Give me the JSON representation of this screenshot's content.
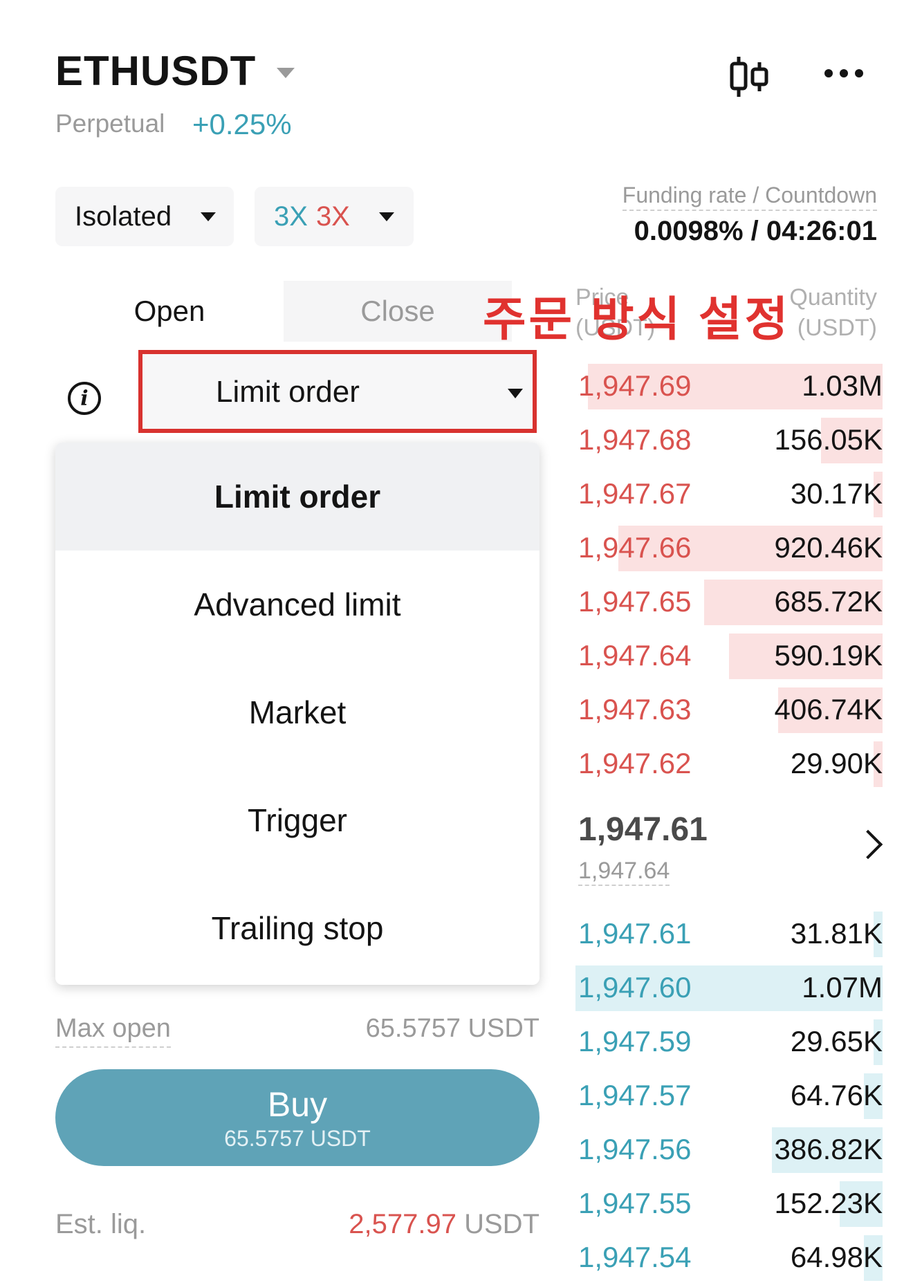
{
  "header": {
    "symbol": "ETHUSDT",
    "contract_type": "Perpetual",
    "change": "+0.25%",
    "icons": [
      "chart-toggle-icon",
      "more-icon"
    ]
  },
  "margin": {
    "mode": "Isolated",
    "leverage_long": "3X",
    "leverage_short": "3X"
  },
  "funding": {
    "label": "Funding rate / Countdown",
    "value": "0.0098% / 04:26:01"
  },
  "tabs": {
    "open": "Open",
    "close": "Close"
  },
  "annotation": "주문 방식 설정",
  "order_type": {
    "selected": "Limit order",
    "options": [
      "Limit order",
      "Advanced limit",
      "Market",
      "Trigger",
      "Trailing stop"
    ]
  },
  "orderbook": {
    "price_header": "Price (USDT)",
    "qty_header": "Quantity (USDT)",
    "price_header_lines": [
      "Price",
      "(USDT)"
    ],
    "qty_header_lines": [
      "Quantity",
      "(USDT)"
    ],
    "asks": [
      {
        "price": "1,947.69",
        "qty": "1.03M",
        "depth": 0.96
      },
      {
        "price": "1,947.68",
        "qty": "156.05K",
        "depth": 0.2
      },
      {
        "price": "1,947.67",
        "qty": "30.17K",
        "depth": 0.03
      },
      {
        "price": "1,947.66",
        "qty": "920.46K",
        "depth": 0.86
      },
      {
        "price": "1,947.65",
        "qty": "685.72K",
        "depth": 0.58
      },
      {
        "price": "1,947.64",
        "qty": "590.19K",
        "depth": 0.5
      },
      {
        "price": "1,947.63",
        "qty": "406.74K",
        "depth": 0.34
      },
      {
        "price": "1,947.62",
        "qty": "29.90K",
        "depth": 0.03
      }
    ],
    "last_price": "1,947.61",
    "mark_price": "1,947.64",
    "bids": [
      {
        "price": "1,947.61",
        "qty": "31.81K",
        "depth": 0.03
      },
      {
        "price": "1,947.60",
        "qty": "1.07M",
        "depth": 1.0
      },
      {
        "price": "1,947.59",
        "qty": "29.65K",
        "depth": 0.03
      },
      {
        "price": "1,947.57",
        "qty": "64.76K",
        "depth": 0.06
      },
      {
        "price": "1,947.56",
        "qty": "386.82K",
        "depth": 0.36
      },
      {
        "price": "1,947.55",
        "qty": "152.23K",
        "depth": 0.14
      },
      {
        "price": "1,947.54",
        "qty": "64.98K",
        "depth": 0.06
      }
    ]
  },
  "footer": {
    "max_open_label": "Max open",
    "max_open_value": "65.5757 USDT",
    "buy_label": "Buy",
    "buy_amount": "65.5757 USDT",
    "est_liq_label": "Est. liq.",
    "est_liq_value": "2,577.97",
    "est_liq_unit": "USDT"
  },
  "colors": {
    "ask": "#d9534f",
    "bid": "#3aa0b5",
    "buy_button": "#5fa3b7",
    "annotation": "#e0322f"
  }
}
